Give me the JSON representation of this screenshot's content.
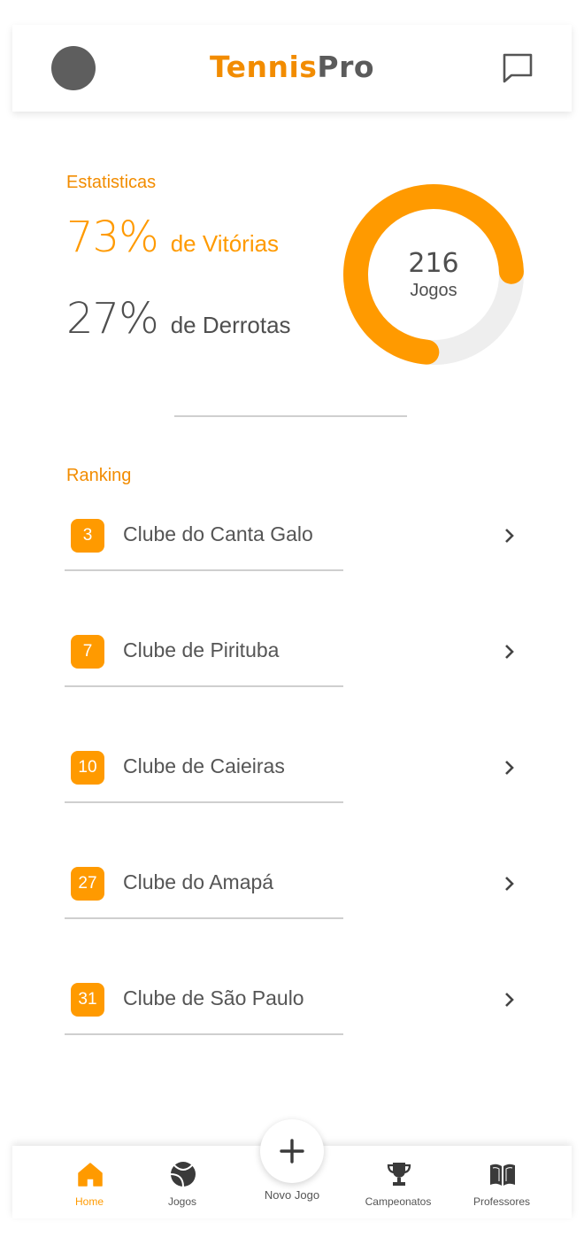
{
  "header": {
    "logo_part1": "Tennis",
    "logo_part2": "Pro"
  },
  "stats": {
    "label": "Estatisticas",
    "win_pct": "73%",
    "win_label": "de Vitórias",
    "loss_pct": "27%",
    "loss_label": "de Derrotas",
    "win_fraction": 0.73,
    "total_games": "216",
    "games_label": "Jogos"
  },
  "ranking": {
    "label": "Ranking",
    "items": [
      {
        "rank": "3",
        "name": "Clube do Canta Galo"
      },
      {
        "rank": "7",
        "name": "Clube de Pirituba"
      },
      {
        "rank": "10",
        "name": "Clube de Caieiras"
      },
      {
        "rank": "27",
        "name": "Clube do Amapá"
      },
      {
        "rank": "31",
        "name": "Clube de São Paulo"
      }
    ]
  },
  "nav": {
    "items": [
      {
        "label": "Home",
        "icon": "home-icon"
      },
      {
        "label": "Jogos",
        "icon": "tennis-ball-icon"
      },
      {
        "label": "Campeonatos",
        "icon": "trophy-icon"
      },
      {
        "label": "Professores",
        "icon": "book-icon"
      }
    ],
    "fab_label": "Novo Jogo",
    "fab_icon": "plus-icon"
  },
  "colors": {
    "accent": "#FF9A00",
    "accent_dark": "#F28C00",
    "track": "#EEEEEE",
    "text": "#555555",
    "avatar": "#5E5E5E"
  }
}
